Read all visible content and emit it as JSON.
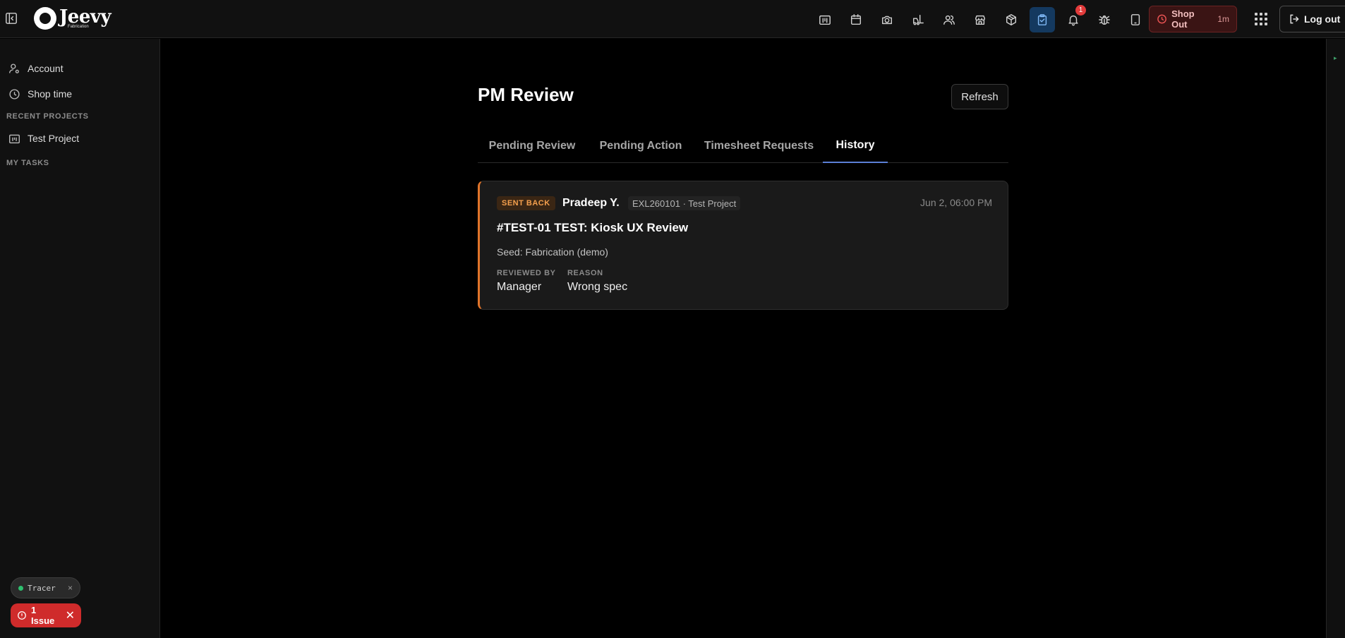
{
  "header": {
    "logo_word": "Jeevy",
    "logo_sub": "Fabrication",
    "nav_icons": [
      {
        "name": "projects-board-icon",
        "active": false
      },
      {
        "name": "calendar-icon",
        "active": false
      },
      {
        "name": "camera-icon",
        "active": false
      },
      {
        "name": "forklift-icon",
        "active": false
      },
      {
        "name": "users-icon",
        "active": false
      },
      {
        "name": "store-icon",
        "active": false
      },
      {
        "name": "package-icon",
        "active": false
      },
      {
        "name": "clipboard-check-icon",
        "active": true
      },
      {
        "name": "bell-icon",
        "active": false
      },
      {
        "name": "bug-icon",
        "active": false
      },
      {
        "name": "tablet-icon",
        "active": false
      }
    ],
    "notification_count": "1",
    "shop_out": {
      "label": "Shop Out",
      "duration": "1m"
    },
    "logout_label": "Log out"
  },
  "sidebar": {
    "items": [
      {
        "label": "Account",
        "icon": "user-gear-icon"
      },
      {
        "label": "Shop time",
        "icon": "clock-icon"
      }
    ],
    "recent_heading": "RECENT PROJECTS",
    "recent_projects": [
      {
        "label": "Test Project",
        "icon": "projects-board-icon"
      }
    ],
    "tasks_heading": "MY TASKS"
  },
  "devtools": {
    "tracer_label": "Tracer",
    "issue_label": "1 Issue"
  },
  "main": {
    "title": "PM Review",
    "refresh_label": "Refresh",
    "tabs": [
      {
        "label": "Pending Review",
        "active": false
      },
      {
        "label": "Pending Action",
        "active": false
      },
      {
        "label": "Timesheet Requests",
        "active": false
      },
      {
        "label": "History",
        "active": true
      }
    ],
    "history": [
      {
        "status": "SENT BACK",
        "submitter": "Pradeep Y.",
        "project": "EXL260101 · Test Project",
        "timestamp": "Jun 2, 06:00 PM",
        "title": "#TEST-01 TEST: Kiosk UX Review",
        "seed": "Seed: Fabrication (demo)",
        "reviewed_by_label": "REVIEWED BY",
        "reviewed_by": "Manager",
        "reason_label": "REASON",
        "reason": "Wrong spec"
      }
    ]
  },
  "colors": {
    "accent": "#5b7fd6",
    "sent_back": "#e0742a",
    "danger": "#cf2b2b",
    "active_nav": "#14395f"
  }
}
